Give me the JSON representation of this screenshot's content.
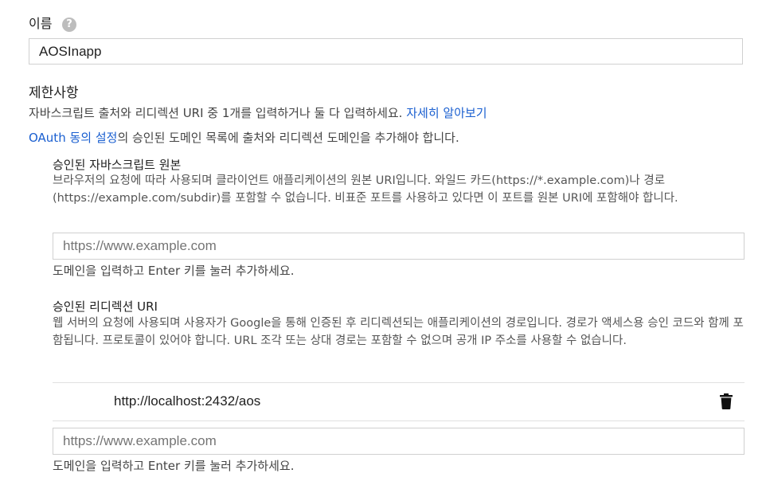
{
  "name_field": {
    "label": "이름",
    "help_icon": "question-mark-icon",
    "help_glyph": "?",
    "value": "AOSInapp"
  },
  "restrictions": {
    "title": "제한사항",
    "desc": "자바스크립트 출처와 리디렉션 URI 중 1개를 입력하거나 둘 다 입력하세요. ",
    "learn_more": "자세히 알아보기",
    "oauth_link": "OAuth 동의 설정",
    "oauth_rest": "의 승인된 도메인 목록에 출처와 리디렉션 도메인을 추가해야 합니다."
  },
  "js_origins": {
    "title": "승인된 자바스크립트 원본",
    "desc": "브라우저의 요청에 따라 사용되며 클라이언트 애플리케이션의 원본 URI입니다. 와일드 카드(https://*.example.com)나 경로(https://example.com/subdir)를 포함할 수 없습니다. 비표준 포트를 사용하고 있다면 이 포트를 원본 URI에 포함해야 합니다.",
    "placeholder": "https://www.example.com",
    "hint": "도메인을 입력하고 Enter 키를 눌러 추가하세요."
  },
  "redirect_uris": {
    "title": "승인된 리디렉션 URI",
    "desc": "웹 서버의 요청에 사용되며 사용자가 Google을 통해 인증된 후 리디렉션되는 애플리케이션의 경로입니다. 경로가 액세스용 승인 코드와 함께 포함됩니다. 프로토콜이 있어야 합니다. URL 조각 또는 상대 경로는 포함할 수 없으며 공개 IP 주소를 사용할 수 없습니다.",
    "items": [
      {
        "uri": "http://localhost:2432/aos",
        "delete_icon": "trash-icon"
      }
    ],
    "placeholder": "https://www.example.com",
    "hint": "도메인을 입력하고 Enter 키를 눌러 추가하세요."
  }
}
